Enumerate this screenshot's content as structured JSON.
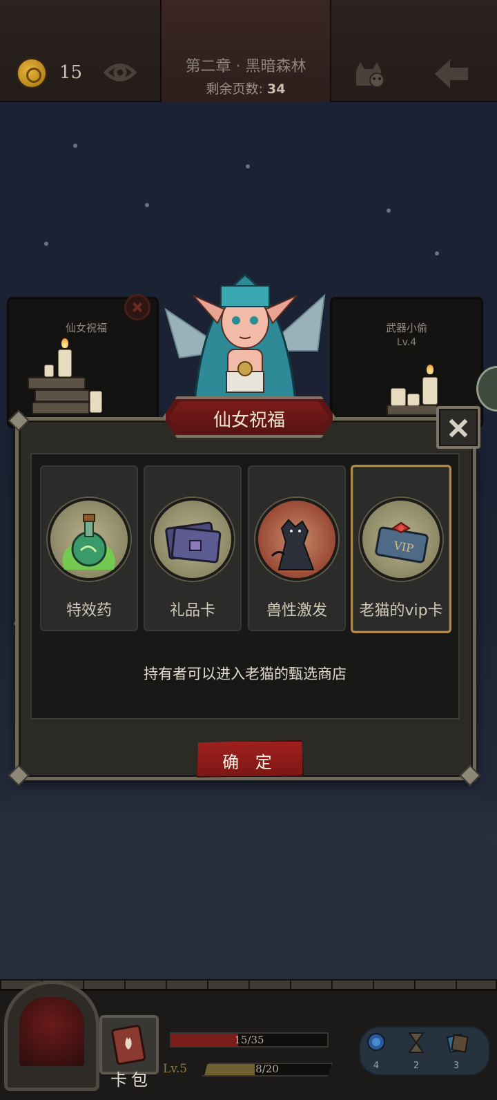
{
  "topbar": {
    "coin_count": "15",
    "chapter_title": "第二章 · 黑暗森林",
    "pages_left_label": "剩余页数:",
    "pages_left_value": "34"
  },
  "background_cards": {
    "left": {
      "label": "仙女祝福"
    },
    "right": {
      "label": "武器小偷",
      "level": "Lv.4"
    }
  },
  "modal": {
    "title": "仙女祝福",
    "options": [
      {
        "label": "特效药",
        "icon": "potion-icon",
        "selected": false
      },
      {
        "label": "礼品卡",
        "icon": "gift-card-icon",
        "selected": false
      },
      {
        "label": "兽性激发",
        "icon": "werewolf-icon",
        "selected": false
      },
      {
        "label": "老猫的vip卡",
        "icon": "vip-card-icon",
        "selected": true
      }
    ],
    "description": "持有者可以进入老猫的甄选商店",
    "confirm_label": "确 定"
  },
  "bottombar": {
    "bag_label": "卡包",
    "hp_text": "15/35",
    "hp_fraction": 0.43,
    "level_text": "Lv.5",
    "xp_text": "8/20",
    "xp_fraction": 0.4,
    "items": [
      {
        "icon": "compass-icon",
        "count": "4"
      },
      {
        "icon": "hourglass-icon",
        "count": "2"
      },
      {
        "icon": "card-icon",
        "count": "3"
      }
    ]
  },
  "colors": {
    "accent_red": "#7a1c1a",
    "selected_border": "#b08a4c",
    "panel_bg": "#2b2a25"
  }
}
